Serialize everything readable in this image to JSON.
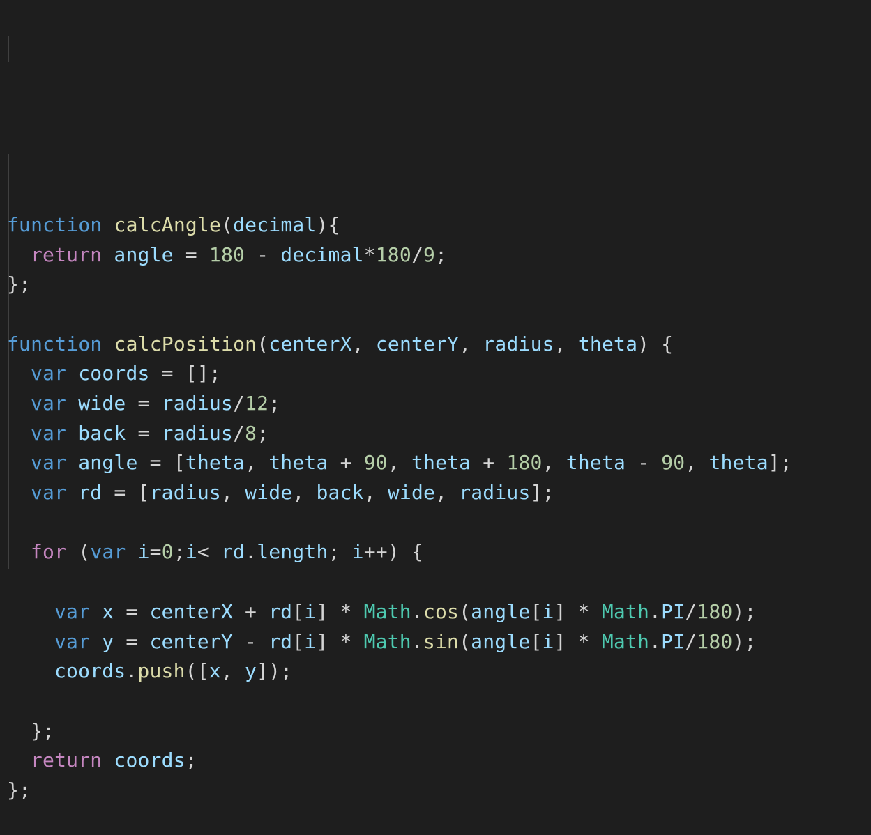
{
  "editor": {
    "lines": [
      {
        "indent": 0,
        "tokens": [
          {
            "t": "function",
            "c": "kw"
          },
          {
            "t": " ",
            "c": "op"
          },
          {
            "t": "calcAngle",
            "c": "fn"
          },
          {
            "t": "(",
            "c": "pun"
          },
          {
            "t": "decimal",
            "c": "prm"
          },
          {
            "t": ")",
            "c": "pun"
          },
          {
            "t": "{",
            "c": "pun"
          }
        ]
      },
      {
        "indent": 1,
        "tokens": [
          {
            "t": "return",
            "c": "ctl"
          },
          {
            "t": " ",
            "c": "op"
          },
          {
            "t": "angle",
            "c": "prm"
          },
          {
            "t": " = ",
            "c": "op"
          },
          {
            "t": "180",
            "c": "num"
          },
          {
            "t": " - ",
            "c": "op"
          },
          {
            "t": "decimal",
            "c": "prm"
          },
          {
            "t": "*",
            "c": "op"
          },
          {
            "t": "180",
            "c": "num"
          },
          {
            "t": "/",
            "c": "op"
          },
          {
            "t": "9",
            "c": "num"
          },
          {
            "t": ";",
            "c": "pun"
          }
        ]
      },
      {
        "indent": 0,
        "tokens": [
          {
            "t": "};",
            "c": "pun"
          }
        ]
      },
      {
        "indent": 0,
        "tokens": []
      },
      {
        "indent": 0,
        "tokens": [
          {
            "t": "function",
            "c": "kw"
          },
          {
            "t": " ",
            "c": "op"
          },
          {
            "t": "calcPosition",
            "c": "fn"
          },
          {
            "t": "(",
            "c": "pun"
          },
          {
            "t": "centerX",
            "c": "prm"
          },
          {
            "t": ", ",
            "c": "pun"
          },
          {
            "t": "centerY",
            "c": "prm"
          },
          {
            "t": ", ",
            "c": "pun"
          },
          {
            "t": "radius",
            "c": "prm"
          },
          {
            "t": ", ",
            "c": "pun"
          },
          {
            "t": "theta",
            "c": "prm"
          },
          {
            "t": ") {",
            "c": "pun"
          }
        ]
      },
      {
        "indent": 1,
        "tokens": [
          {
            "t": "var",
            "c": "kw"
          },
          {
            "t": " ",
            "c": "op"
          },
          {
            "t": "coords",
            "c": "prm"
          },
          {
            "t": " = ",
            "c": "op"
          },
          {
            "t": "[];",
            "c": "pun"
          }
        ]
      },
      {
        "indent": 1,
        "tokens": [
          {
            "t": "var",
            "c": "kw"
          },
          {
            "t": " ",
            "c": "op"
          },
          {
            "t": "wide",
            "c": "prm"
          },
          {
            "t": " = ",
            "c": "op"
          },
          {
            "t": "radius",
            "c": "prm"
          },
          {
            "t": "/",
            "c": "op"
          },
          {
            "t": "12",
            "c": "num"
          },
          {
            "t": ";",
            "c": "pun"
          }
        ]
      },
      {
        "indent": 1,
        "tokens": [
          {
            "t": "var",
            "c": "kw"
          },
          {
            "t": " ",
            "c": "op"
          },
          {
            "t": "back",
            "c": "prm"
          },
          {
            "t": " = ",
            "c": "op"
          },
          {
            "t": "radius",
            "c": "prm"
          },
          {
            "t": "/",
            "c": "op"
          },
          {
            "t": "8",
            "c": "num"
          },
          {
            "t": ";",
            "c": "pun"
          }
        ]
      },
      {
        "indent": 1,
        "tokens": [
          {
            "t": "var",
            "c": "kw"
          },
          {
            "t": " ",
            "c": "op"
          },
          {
            "t": "angle",
            "c": "prm"
          },
          {
            "t": " = ",
            "c": "op"
          },
          {
            "t": "[",
            "c": "pun"
          },
          {
            "t": "theta",
            "c": "prm"
          },
          {
            "t": ", ",
            "c": "pun"
          },
          {
            "t": "theta",
            "c": "prm"
          },
          {
            "t": " + ",
            "c": "op"
          },
          {
            "t": "90",
            "c": "num"
          },
          {
            "t": ", ",
            "c": "pun"
          },
          {
            "t": "theta",
            "c": "prm"
          },
          {
            "t": " + ",
            "c": "op"
          },
          {
            "t": "180",
            "c": "num"
          },
          {
            "t": ", ",
            "c": "pun"
          },
          {
            "t": "theta",
            "c": "prm"
          },
          {
            "t": " - ",
            "c": "op"
          },
          {
            "t": "90",
            "c": "num"
          },
          {
            "t": ", ",
            "c": "pun"
          },
          {
            "t": "theta",
            "c": "prm"
          },
          {
            "t": "];",
            "c": "pun"
          }
        ]
      },
      {
        "indent": 1,
        "tokens": [
          {
            "t": "var",
            "c": "kw"
          },
          {
            "t": " ",
            "c": "op"
          },
          {
            "t": "rd",
            "c": "prm"
          },
          {
            "t": " = ",
            "c": "op"
          },
          {
            "t": "[",
            "c": "pun"
          },
          {
            "t": "radius",
            "c": "prm"
          },
          {
            "t": ", ",
            "c": "pun"
          },
          {
            "t": "wide",
            "c": "prm"
          },
          {
            "t": ", ",
            "c": "pun"
          },
          {
            "t": "back",
            "c": "prm"
          },
          {
            "t": ", ",
            "c": "pun"
          },
          {
            "t": "wide",
            "c": "prm"
          },
          {
            "t": ", ",
            "c": "pun"
          },
          {
            "t": "radius",
            "c": "prm"
          },
          {
            "t": "];",
            "c": "pun"
          }
        ]
      },
      {
        "indent": 0,
        "tokens": []
      },
      {
        "indent": 1,
        "tokens": [
          {
            "t": "for",
            "c": "ctl"
          },
          {
            "t": " ",
            "c": "op"
          },
          {
            "t": "(",
            "c": "pun"
          },
          {
            "t": "var",
            "c": "kw"
          },
          {
            "t": " ",
            "c": "op"
          },
          {
            "t": "i",
            "c": "prm"
          },
          {
            "t": "=",
            "c": "op"
          },
          {
            "t": "0",
            "c": "num"
          },
          {
            "t": ";",
            "c": "pun"
          },
          {
            "t": "i",
            "c": "prm"
          },
          {
            "t": "< ",
            "c": "op"
          },
          {
            "t": "rd",
            "c": "prm"
          },
          {
            "t": ".",
            "c": "pun"
          },
          {
            "t": "length",
            "c": "prm"
          },
          {
            "t": "; ",
            "c": "pun"
          },
          {
            "t": "i",
            "c": "prm"
          },
          {
            "t": "++",
            "c": "op"
          },
          {
            "t": ") {",
            "c": "pun"
          }
        ]
      },
      {
        "indent": 0,
        "tokens": []
      },
      {
        "indent": 2,
        "tokens": [
          {
            "t": "var",
            "c": "kw"
          },
          {
            "t": " ",
            "c": "op"
          },
          {
            "t": "x",
            "c": "prm"
          },
          {
            "t": " = ",
            "c": "op"
          },
          {
            "t": "centerX",
            "c": "prm"
          },
          {
            "t": " + ",
            "c": "op"
          },
          {
            "t": "rd",
            "c": "prm"
          },
          {
            "t": "[",
            "c": "pun"
          },
          {
            "t": "i",
            "c": "prm"
          },
          {
            "t": "]",
            "c": "pun"
          },
          {
            "t": " * ",
            "c": "op"
          },
          {
            "t": "Math",
            "c": "typ"
          },
          {
            "t": ".",
            "c": "pun"
          },
          {
            "t": "cos",
            "c": "fn"
          },
          {
            "t": "(",
            "c": "pun"
          },
          {
            "t": "angle",
            "c": "prm"
          },
          {
            "t": "[",
            "c": "pun"
          },
          {
            "t": "i",
            "c": "prm"
          },
          {
            "t": "]",
            "c": "pun"
          },
          {
            "t": " * ",
            "c": "op"
          },
          {
            "t": "Math",
            "c": "typ"
          },
          {
            "t": ".",
            "c": "pun"
          },
          {
            "t": "PI",
            "c": "prm"
          },
          {
            "t": "/",
            "c": "op"
          },
          {
            "t": "180",
            "c": "num"
          },
          {
            "t": ");",
            "c": "pun"
          }
        ]
      },
      {
        "indent": 2,
        "tokens": [
          {
            "t": "var",
            "c": "kw"
          },
          {
            "t": " ",
            "c": "op"
          },
          {
            "t": "y",
            "c": "prm"
          },
          {
            "t": " = ",
            "c": "op"
          },
          {
            "t": "centerY",
            "c": "prm"
          },
          {
            "t": " - ",
            "c": "op"
          },
          {
            "t": "rd",
            "c": "prm"
          },
          {
            "t": "[",
            "c": "pun"
          },
          {
            "t": "i",
            "c": "prm"
          },
          {
            "t": "]",
            "c": "pun"
          },
          {
            "t": " * ",
            "c": "op"
          },
          {
            "t": "Math",
            "c": "typ"
          },
          {
            "t": ".",
            "c": "pun"
          },
          {
            "t": "sin",
            "c": "fn"
          },
          {
            "t": "(",
            "c": "pun"
          },
          {
            "t": "angle",
            "c": "prm"
          },
          {
            "t": "[",
            "c": "pun"
          },
          {
            "t": "i",
            "c": "prm"
          },
          {
            "t": "]",
            "c": "pun"
          },
          {
            "t": " * ",
            "c": "op"
          },
          {
            "t": "Math",
            "c": "typ"
          },
          {
            "t": ".",
            "c": "pun"
          },
          {
            "t": "PI",
            "c": "prm"
          },
          {
            "t": "/",
            "c": "op"
          },
          {
            "t": "180",
            "c": "num"
          },
          {
            "t": ");",
            "c": "pun"
          }
        ]
      },
      {
        "indent": 2,
        "tokens": [
          {
            "t": "coords",
            "c": "prm"
          },
          {
            "t": ".",
            "c": "pun"
          },
          {
            "t": "push",
            "c": "fn"
          },
          {
            "t": "([",
            "c": "pun"
          },
          {
            "t": "x",
            "c": "prm"
          },
          {
            "t": ", ",
            "c": "pun"
          },
          {
            "t": "y",
            "c": "prm"
          },
          {
            "t": "]);",
            "c": "pun"
          }
        ]
      },
      {
        "indent": 0,
        "tokens": []
      },
      {
        "indent": 1,
        "tokens": [
          {
            "t": "};",
            "c": "pun"
          }
        ]
      },
      {
        "indent": 1,
        "tokens": [
          {
            "t": "return",
            "c": "ctl"
          },
          {
            "t": " ",
            "c": "op"
          },
          {
            "t": "coords",
            "c": "prm"
          },
          {
            "t": ";",
            "c": "pun"
          }
        ]
      },
      {
        "indent": 0,
        "tokens": [
          {
            "t": "};",
            "c": "pun"
          }
        ]
      }
    ]
  }
}
